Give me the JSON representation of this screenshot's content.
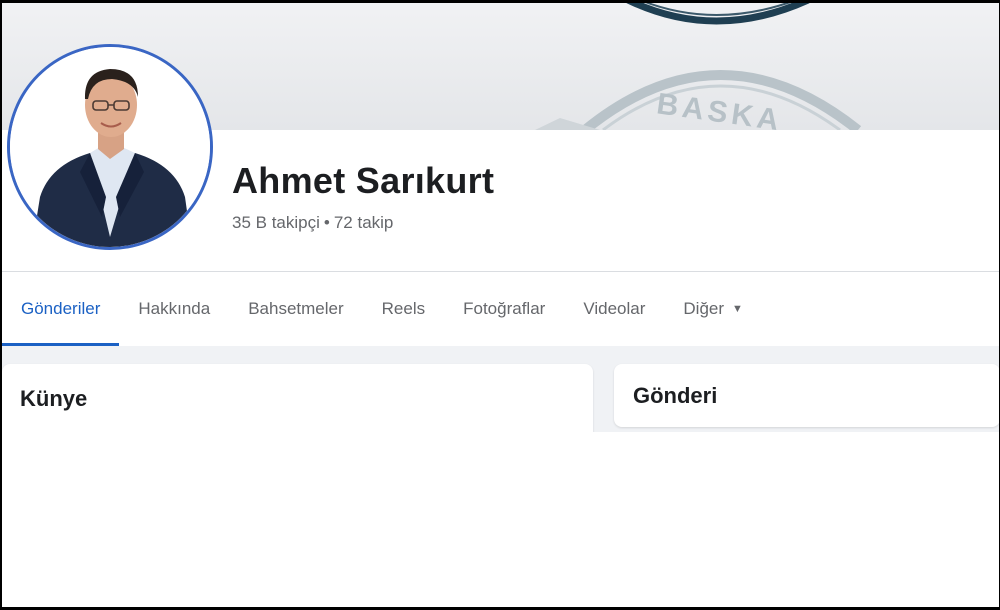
{
  "profile": {
    "name": "Ahmet Sarıkurt",
    "followers": "35 B takipçi",
    "separator": "•",
    "following": "72 takip"
  },
  "cover": {
    "watermark_text": "BASKA"
  },
  "tabs": [
    {
      "label": "Gönderiler",
      "active": true
    },
    {
      "label": "Hakkında",
      "active": false
    },
    {
      "label": "Bahsetmeler",
      "active": false
    },
    {
      "label": "Reels",
      "active": false
    },
    {
      "label": "Fotoğraflar",
      "active": false
    },
    {
      "label": "Videolar",
      "active": false
    },
    {
      "label": "Diğer",
      "active": false,
      "icon": "caret-down-icon"
    }
  ],
  "cards": {
    "left_title": "Künye",
    "right_title": "Gönderi"
  },
  "colors": {
    "accent": "#1b61c4",
    "avatar_ring": "#3a66c4",
    "text_primary": "#1c1e21",
    "text_secondary": "#65676b",
    "page_bg": "#f0f2f5"
  }
}
